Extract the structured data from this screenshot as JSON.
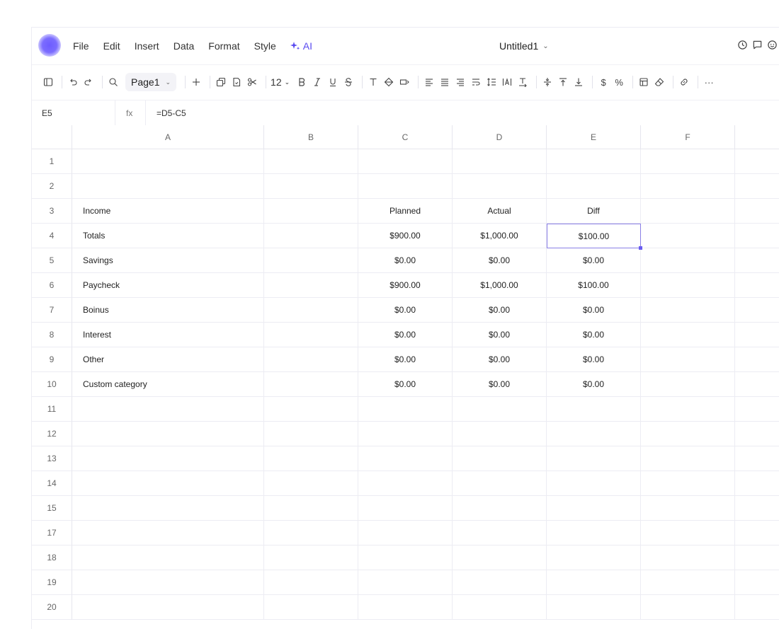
{
  "menubar": {
    "items": [
      "File",
      "Edit",
      "Insert",
      "Data",
      "Format",
      "Style"
    ],
    "ai_label": "AI",
    "title": "Untitled1"
  },
  "toolbar": {
    "page_label": "Page1",
    "font_size": "12",
    "dollar": "$",
    "percent": "%",
    "more": "···"
  },
  "formula_bar": {
    "cell_ref": "E5",
    "fx_label": "fx",
    "formula": "=D5-C5"
  },
  "sheet": {
    "columns": [
      "A",
      "B",
      "C",
      "D",
      "E",
      "F"
    ],
    "row_numbers": [
      "1",
      "2",
      "3",
      "4",
      "5",
      "6",
      "7",
      "8",
      "9",
      "10",
      "11",
      "12",
      "13",
      "14",
      "15",
      "17",
      "18",
      "19",
      "20"
    ],
    "rows": [
      [
        "",
        "",
        "",
        "",
        ""
      ],
      [
        "",
        "",
        "",
        "",
        ""
      ],
      [
        "Income",
        "",
        "Planned",
        "Actual",
        "Diff"
      ],
      [
        "Totals",
        "",
        "$900.00",
        "$1,000.00",
        "$100.00"
      ],
      [
        "Savings",
        "",
        "$0.00",
        "$0.00",
        "$0.00"
      ],
      [
        "Paycheck",
        "",
        "$900.00",
        "$1,000.00",
        "$100.00"
      ],
      [
        "Boinus",
        "",
        "$0.00",
        "$0.00",
        "$0.00"
      ],
      [
        "Interest",
        "",
        "$0.00",
        "$0.00",
        "$0.00"
      ],
      [
        "Other",
        "",
        "$0.00",
        "$0.00",
        "$0.00"
      ],
      [
        "Custom category",
        "",
        "$0.00",
        "$0.00",
        "$0.00"
      ]
    ],
    "selected_cell": "E4"
  },
  "colors": {
    "accent": "#5a4bf0",
    "selection_border": "#8a7fe6",
    "grid_line": "#ececf3"
  }
}
